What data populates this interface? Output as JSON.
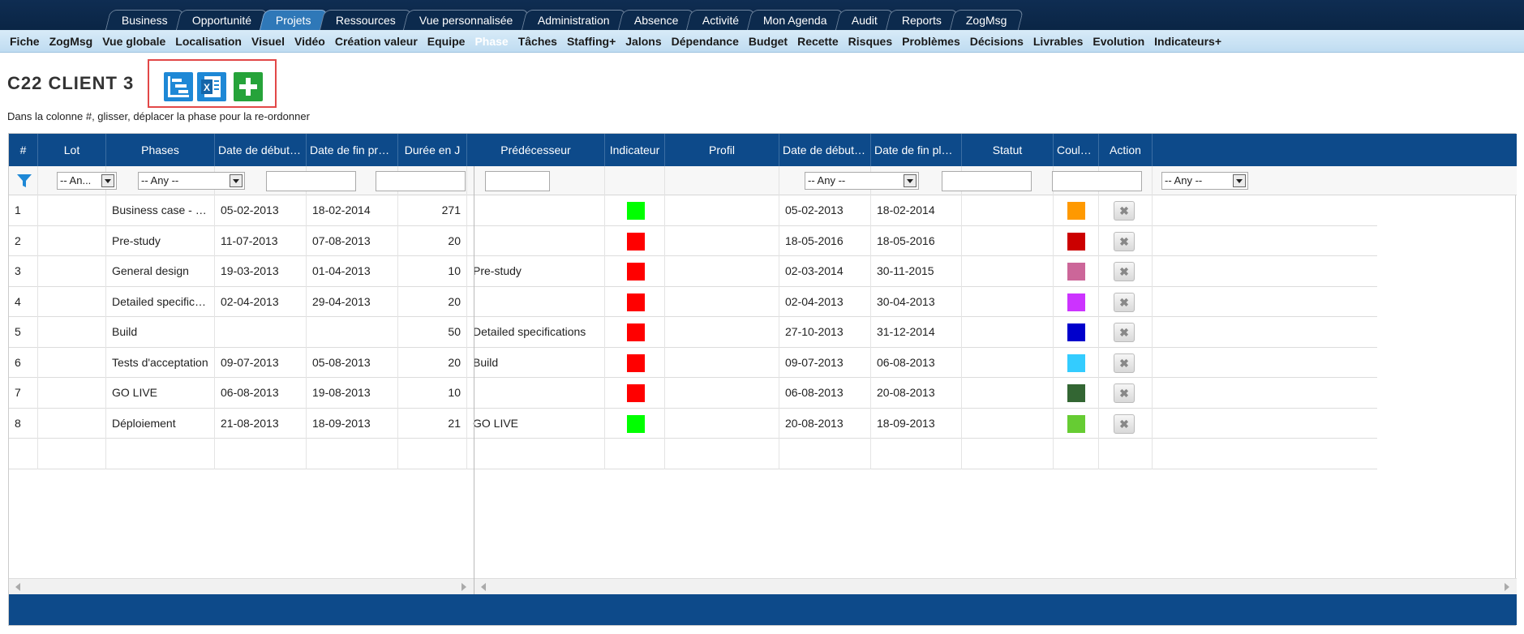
{
  "top_tabs": [
    "Business",
    "Opportunité",
    "Projets",
    "Ressources",
    "Vue personnalisée",
    "Administration",
    "Absence",
    "Activité",
    "Mon Agenda",
    "Audit",
    "Reports",
    "ZogMsg"
  ],
  "top_tab_active": "Projets",
  "sub_menu": [
    "Fiche",
    "ZogMsg",
    "Vue globale",
    "Localisation",
    "Visuel",
    "Vidéo",
    "Création valeur",
    "Equipe",
    "Phase",
    "Tâches",
    "Staffing+",
    "Jalons",
    "Dépendance",
    "Budget",
    "Recette",
    "Risques",
    "Problèmes",
    "Décisions",
    "Livrables",
    "Evolution",
    "Indicateurs+"
  ],
  "sub_menu_active": "Phase",
  "page": {
    "title": "C22 CLIENT 3",
    "hint": "Dans la colonne #, glisser, déplacer la phase pour la re-ordonner",
    "toolbar": {
      "gantt_icon": "gantt-icon",
      "excel_icon": "excel-icon",
      "add_icon": "plus-icon"
    }
  },
  "grid": {
    "columns": [
      "#",
      "Lot",
      "Phases",
      "Date de début pré...",
      "Date de fin prévue",
      "Durée en J",
      "Prédécesseur",
      "Indicateur",
      "Profil",
      "Date de début pla...",
      "Date de fin planifié",
      "Statut",
      "Couleur",
      "Action"
    ],
    "filters": {
      "lot": "-- An...",
      "phases": "-- Any --",
      "profil": "-- Any --",
      "statut": "-- Any --"
    },
    "rows": [
      {
        "num": "1",
        "lot": "",
        "phase": "Business case - Requ...",
        "start_prev": "05-02-2013",
        "end_prev": "18-02-2014",
        "duration": "271",
        "pred": "",
        "indicator": "#00ff00",
        "profil": "",
        "start_plan": "05-02-2013",
        "end_plan": "18-02-2014",
        "statut": "",
        "color": "#ff9900"
      },
      {
        "num": "2",
        "lot": "",
        "phase": "Pre-study",
        "start_prev": "11-07-2013",
        "end_prev": "07-08-2013",
        "duration": "20",
        "pred": "",
        "indicator": "#ff0000",
        "profil": "",
        "start_plan": "18-05-2016",
        "end_plan": "18-05-2016",
        "statut": "",
        "color": "#cc0000"
      },
      {
        "num": "3",
        "lot": "",
        "phase": "General design",
        "start_prev": "19-03-2013",
        "end_prev": "01-04-2013",
        "duration": "10",
        "pred": "Pre-study",
        "indicator": "#ff0000",
        "profil": "",
        "start_plan": "02-03-2014",
        "end_plan": "30-11-2015",
        "statut": "",
        "color": "#cc6699"
      },
      {
        "num": "4",
        "lot": "",
        "phase": "Detailed specifications",
        "start_prev": "02-04-2013",
        "end_prev": "29-04-2013",
        "duration": "20",
        "pred": "",
        "indicator": "#ff0000",
        "profil": "",
        "start_plan": "02-04-2013",
        "end_plan": "30-04-2013",
        "statut": "",
        "color": "#cc33ff"
      },
      {
        "num": "5",
        "lot": "",
        "phase": "Build",
        "start_prev": "",
        "end_prev": "",
        "duration": "50",
        "pred": "Detailed specifications",
        "indicator": "#ff0000",
        "profil": "",
        "start_plan": "27-10-2013",
        "end_plan": "31-12-2014",
        "statut": "",
        "color": "#0000cc"
      },
      {
        "num": "6",
        "lot": "",
        "phase": "Tests d'acceptation",
        "start_prev": "09-07-2013",
        "end_prev": "05-08-2013",
        "duration": "20",
        "pred": "Build",
        "indicator": "#ff0000",
        "profil": "",
        "start_plan": "09-07-2013",
        "end_plan": "06-08-2013",
        "statut": "",
        "color": "#33ccff"
      },
      {
        "num": "7",
        "lot": "",
        "phase": "GO LIVE",
        "start_prev": "06-08-2013",
        "end_prev": "19-08-2013",
        "duration": "10",
        "pred": "",
        "indicator": "#ff0000",
        "profil": "",
        "start_plan": "06-08-2013",
        "end_plan": "20-08-2013",
        "statut": "",
        "color": "#336633"
      },
      {
        "num": "8",
        "lot": "",
        "phase": "Déploiement",
        "start_prev": "21-08-2013",
        "end_prev": "18-09-2013",
        "duration": "21",
        "pred": "GO LIVE",
        "indicator": "#00ff00",
        "profil": "",
        "start_plan": "20-08-2013",
        "end_plan": "18-09-2013",
        "statut": "",
        "color": "#66cc33"
      }
    ]
  }
}
